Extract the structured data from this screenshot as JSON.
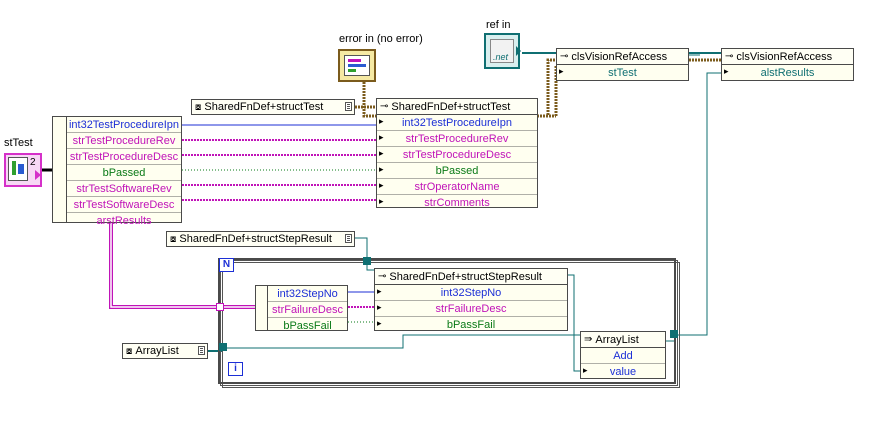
{
  "labels": {
    "error_in": "error in (no error)",
    "ref_in": "ref in",
    "st_test": "stTest",
    "net_text": ".net"
  },
  "st_test_terminal": {
    "index_value": "2"
  },
  "unbundle_left": {
    "items": [
      "int32TestProcedureIpn",
      "strTestProcedureRev",
      "strTestProcedureDesc",
      "bPassed",
      "strTestSoftwareRev",
      "strTestSoftwareDesc",
      "arstResults"
    ]
  },
  "const_structtest": {
    "label": "SharedFnDef+structTest"
  },
  "bundle_structtest": {
    "title": "SharedFnDef+structTest",
    "items": [
      "int32TestProcedureIpn",
      "strTestProcedureRev",
      "strTestProcedureDesc",
      "bPassed",
      "strOperatorName",
      "strComments"
    ]
  },
  "property1": {
    "title": "clsVisionRefAccess",
    "prop": "stTest"
  },
  "property2": {
    "title": "clsVisionRefAccess",
    "prop": "alstResults"
  },
  "const_stepresult": {
    "label": "SharedFnDef+structStepResult"
  },
  "loop": {
    "n_label": "N",
    "i_label": "i"
  },
  "unbundle_step": {
    "items": [
      "int32StepNo",
      "strFailureDesc",
      "bPassFail"
    ]
  },
  "bundle_step": {
    "title": "SharedFnDef+structStepResult",
    "items": [
      "int32StepNo",
      "strFailureDesc",
      "bPassFail"
    ]
  },
  "const_arraylist": {
    "label": "ArrayList"
  },
  "invoke_arraylist": {
    "title": "ArrayList",
    "method": "Add",
    "param": "value"
  },
  "colors": {
    "int": "#1c2fd6",
    "string": "#c013b8",
    "bool": "#0a7a17",
    "ref": "#0f6f72",
    "cluster": "#7b5b1c"
  }
}
